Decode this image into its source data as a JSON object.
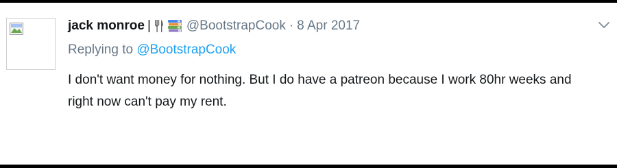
{
  "tweet": {
    "author_name": "jack monroe",
    "separator": "|",
    "emoji_icons": [
      "fork-and-knife-icon",
      "books-icon"
    ],
    "handle": "@BootstrapCook",
    "dot": "·",
    "date": "8 Apr 2017",
    "replying_prefix": "Replying to",
    "replying_handle": "@BootstrapCook",
    "text": "I don't want money for nothing. But I do have a patreon because I work 80hr weeks and right now can't pay my rent.",
    "colors": {
      "text": "#14171a",
      "muted": "#657786",
      "link": "#1da1f2",
      "background": "#ffffff"
    }
  }
}
